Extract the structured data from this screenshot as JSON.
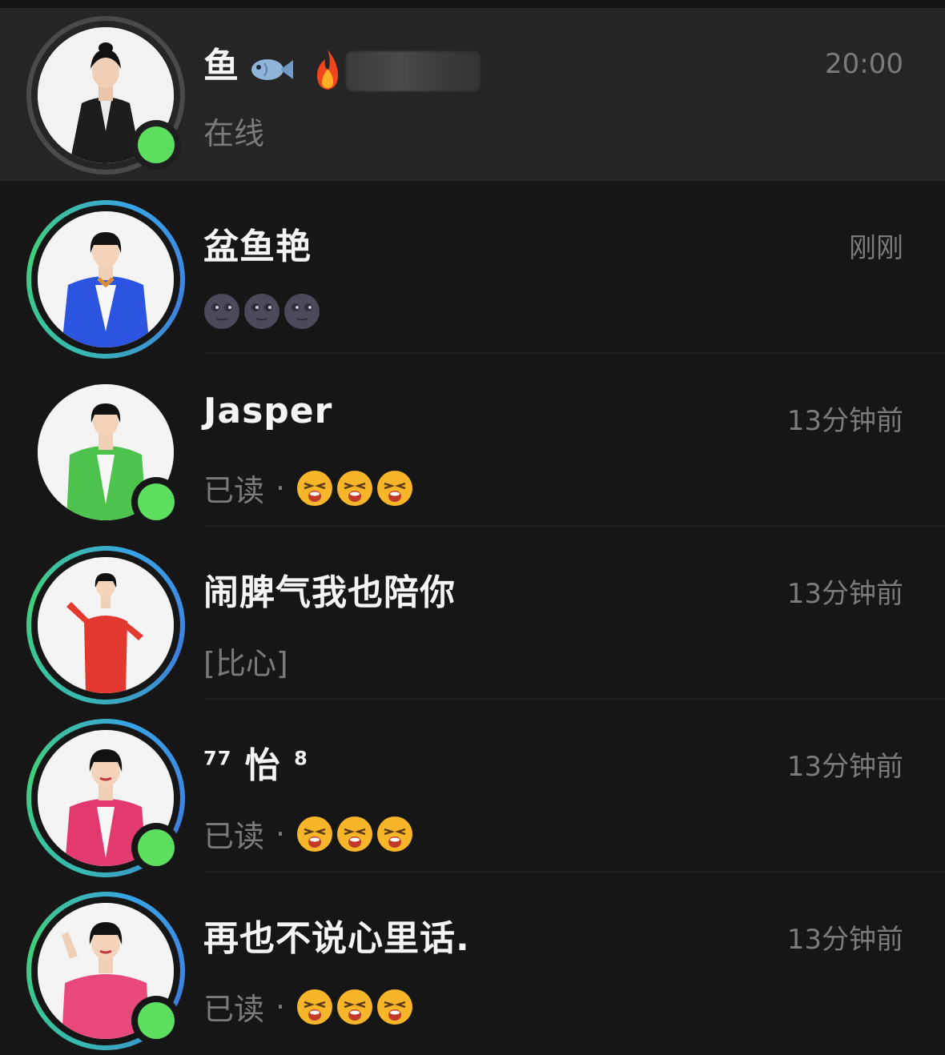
{
  "chats": [
    {
      "name": "鱼",
      "time": "20:00",
      "message": "在线",
      "online": true
    },
    {
      "name": "盆鱼艳",
      "time": "刚刚",
      "message_icon": "new-moon-face-emoji x3",
      "online": false,
      "suit": "#2b55e0"
    },
    {
      "name": "Jasper",
      "time": "13分钟前",
      "read_label": "已读",
      "message_icon": "tired-face-emoji x3",
      "online": true,
      "suit": "#4dc24d"
    },
    {
      "name": "闹脾气我也陪你",
      "time": "13分钟前",
      "message": "[比心]",
      "online": false,
      "suit": "#e2382e"
    },
    {
      "name_sup_left": "77",
      "name": "怡",
      "name_sup_right": "8",
      "time": "13分钟前",
      "read_label": "已读",
      "message_icon": "tired-face-emoji x3",
      "online": true,
      "suit": "#e23a6e"
    },
    {
      "name": "再也不说心里话.",
      "time": "13分钟前",
      "read_label": "已读",
      "message_icon": "tired-face-emoji x3",
      "online": true,
      "suit": "#e8487a"
    }
  ],
  "colors": {
    "online": "#5ede5e",
    "background": "#161616",
    "selected_row": "#252525"
  }
}
